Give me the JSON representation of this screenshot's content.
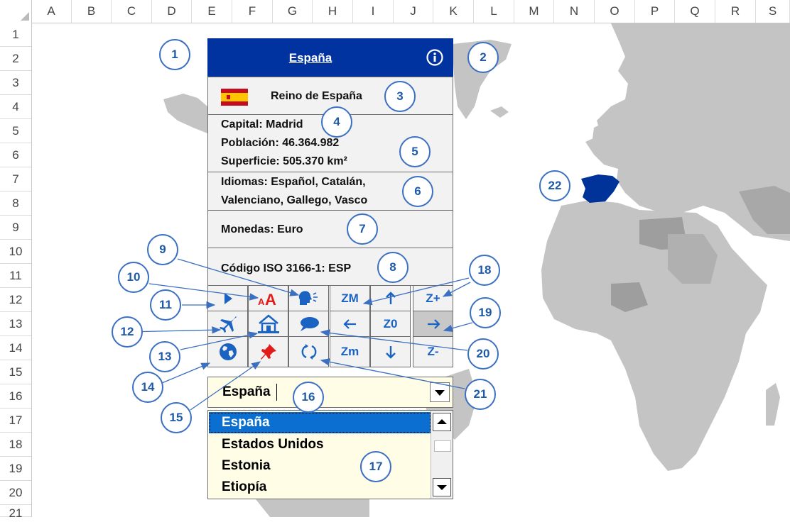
{
  "sheet": {
    "columns": [
      "A",
      "B",
      "C",
      "D",
      "E",
      "F",
      "G",
      "H",
      "I",
      "J",
      "K",
      "L",
      "M",
      "N",
      "O",
      "P",
      "Q",
      "R",
      "S"
    ],
    "rows": [
      "1",
      "2",
      "3",
      "4",
      "5",
      "6",
      "7",
      "8",
      "9",
      "10",
      "11",
      "12",
      "13",
      "14",
      "15",
      "16",
      "17",
      "18",
      "19",
      "20",
      "21"
    ]
  },
  "panel": {
    "title": "España",
    "official_name": "Reino de España",
    "capital": "Capital: Madrid",
    "population": "Población: 46.364.982",
    "area": "Superficie: 505.370 km²",
    "languages_1": "Idiomas: Español, Catalán,",
    "languages_2": "Valenciano, Gallego, Vasco",
    "currencies": "Monedas: Euro",
    "iso": "Código ISO 3166-1: ESP"
  },
  "buttons": {
    "zoom_max": "ZM",
    "zoom_zero": "Z0",
    "zoom_min": "Zm",
    "zoom_in": "Z+",
    "zoom_out": "Z-"
  },
  "icons": {
    "info": "info-icon",
    "play": "play-icon",
    "font_size": "font-size-icon",
    "speak": "speak-icon",
    "plane": "plane-icon",
    "house": "house-icon",
    "chat": "chat-bubble-icon",
    "globe": "globe-icon",
    "pin": "pushpin-icon",
    "reset": "reset-icon",
    "arrow_up": "arrow-up-icon",
    "arrow_left": "arrow-left-icon",
    "arrow_right": "arrow-right-icon",
    "arrow_down": "arrow-down-icon"
  },
  "combo": {
    "value": "España"
  },
  "list": {
    "items": [
      "España",
      "Estados Unidos",
      "Estonia",
      "Etiopía"
    ],
    "selected": "España"
  },
  "callouts": [
    "1",
    "2",
    "3",
    "4",
    "5",
    "6",
    "7",
    "8",
    "9",
    "10",
    "11",
    "12",
    "13",
    "14",
    "15",
    "16",
    "17",
    "18",
    "19",
    "20",
    "21",
    "22"
  ],
  "colors": {
    "header": "#0033a0",
    "accent": "#1a63c2",
    "callout": "#3a6fc1",
    "map_land": "#bfbfbf",
    "map_highlight": "#003399"
  }
}
